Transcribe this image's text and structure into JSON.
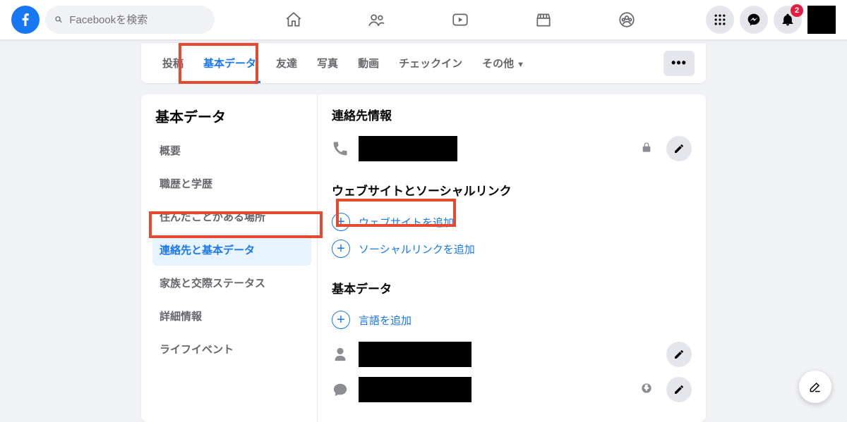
{
  "header": {
    "search_placeholder": "Facebookを検索",
    "notification_badge": "2"
  },
  "tabs": {
    "posts": "投稿",
    "about": "基本データ",
    "friends": "友達",
    "photos": "写真",
    "videos": "動画",
    "checkins": "チェックイン",
    "more": "その他",
    "ellipsis": "•••"
  },
  "about": {
    "heading": "基本データ",
    "side": {
      "overview": "概要",
      "work_edu": "職歴と学歴",
      "places": "住んだことがある場所",
      "contact": "連絡先と基本データ",
      "family": "家族と交際ステータス",
      "details": "詳細情報",
      "life_events": "ライフイベント"
    },
    "sections": {
      "contact_title": "連絡先情報",
      "websites_title": "ウェブサイトとソーシャルリンク",
      "add_website": "ウェブサイトを追加",
      "add_social": "ソーシャルリンクを追加",
      "basic_title": "基本データ",
      "add_language": "言語を追加"
    }
  }
}
